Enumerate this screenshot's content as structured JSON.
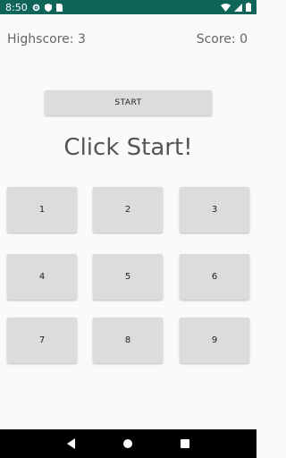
{
  "status_bar": {
    "time": "8:50",
    "bg_color": "#0f6658",
    "icons_left": [
      "gear-icon",
      "shield-icon",
      "sim-card-icon"
    ],
    "icons_right": [
      "wifi-icon",
      "cell-signal-icon",
      "battery-icon"
    ]
  },
  "scores": {
    "highscore_label": "Highscore: 3",
    "score_label": "Score: 0"
  },
  "start_button": {
    "label": "START"
  },
  "message": "Click Start!",
  "grid": {
    "cells": [
      "1",
      "2",
      "3",
      "4",
      "5",
      "6",
      "7",
      "8",
      "9"
    ]
  },
  "nav_bar": {
    "buttons": [
      "back-icon",
      "home-icon",
      "recents-icon"
    ]
  }
}
